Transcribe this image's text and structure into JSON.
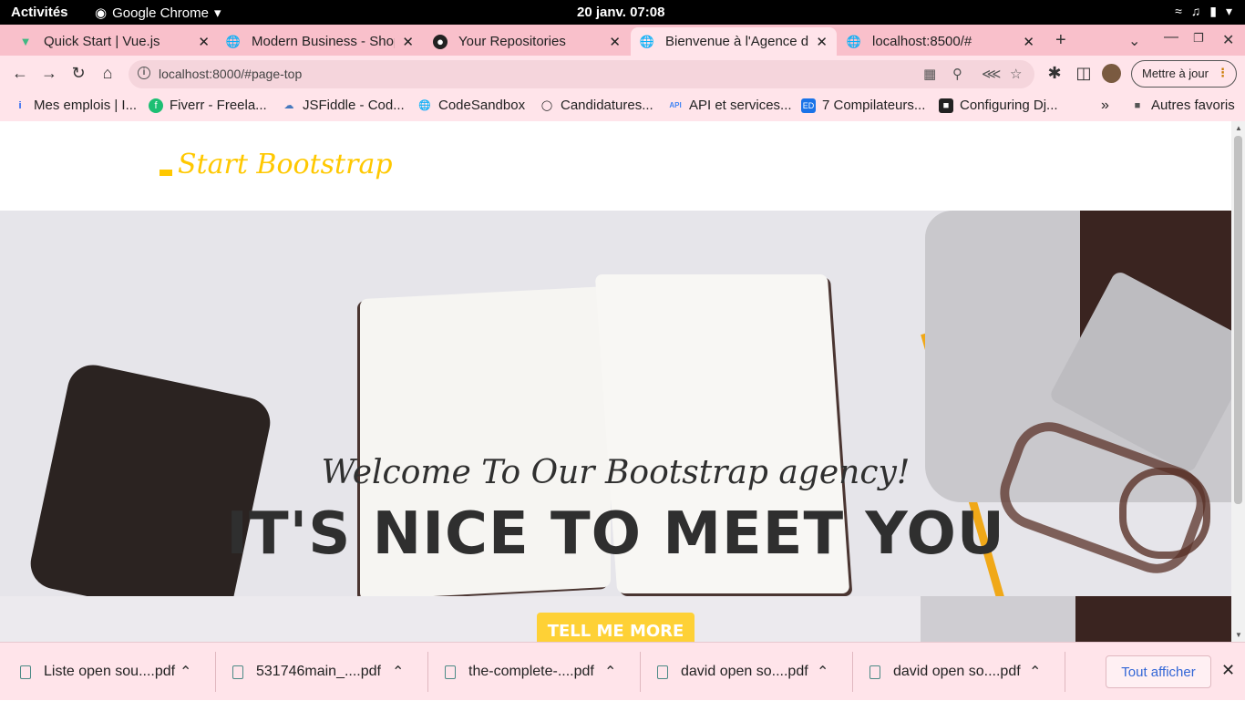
{
  "os": {
    "activities": "Activités",
    "app_name": "Google Chrome",
    "clock": "20 janv.  07:08"
  },
  "tabs": [
    {
      "title": "Quick Start | Vue.js",
      "icon": "vue-icon"
    },
    {
      "title": "Modern Business - Shop",
      "icon": "globe-icon"
    },
    {
      "title": "Your Repositories",
      "icon": "github-icon"
    },
    {
      "title": "Bienvenue à l'Agence du",
      "icon": "globe-icon",
      "active": true
    },
    {
      "title": "localhost:8500/#",
      "icon": "globe-icon"
    }
  ],
  "address_bar": {
    "url": "localhost:8000/#page-top",
    "update_label": "Mettre à jour"
  },
  "bookmarks": [
    {
      "label": "Mes emplois | I...",
      "icon": "indeed-icon"
    },
    {
      "label": "Fiverr - Freela...",
      "icon": "fiverr-icon"
    },
    {
      "label": "JSFiddle - Cod...",
      "icon": "jsfiddle-icon"
    },
    {
      "label": "CodeSandbox",
      "icon": "globe-icon"
    },
    {
      "label": "Candidatures...",
      "icon": "circle-icon"
    },
    {
      "label": "API et services...",
      "icon": "api-icon"
    },
    {
      "label": "7 Compilateurs...",
      "icon": "ed-icon"
    },
    {
      "label": "Configuring Dj...",
      "icon": "bookmark-icon"
    }
  ],
  "other_bookmarks": "Autres favoris",
  "site": {
    "brand": "Start Bootstrap",
    "subheading": "Welcome To Our Bootstrap agency!",
    "heading": "IT'S NICE TO MEET YOU",
    "cta": "TELL ME MORE"
  },
  "downloads": [
    {
      "name": "Liste open sou....pdf"
    },
    {
      "name": "531746main_....pdf"
    },
    {
      "name": "the-complete-....pdf"
    },
    {
      "name": "david open so....pdf"
    },
    {
      "name": "david open so....pdf"
    }
  ],
  "show_all": "Tout afficher",
  "colors": {
    "accent": "#fed136",
    "brand": "#ffc800",
    "tab_strip": "#f9c0cb",
    "toolbar": "#ffe4ea"
  }
}
